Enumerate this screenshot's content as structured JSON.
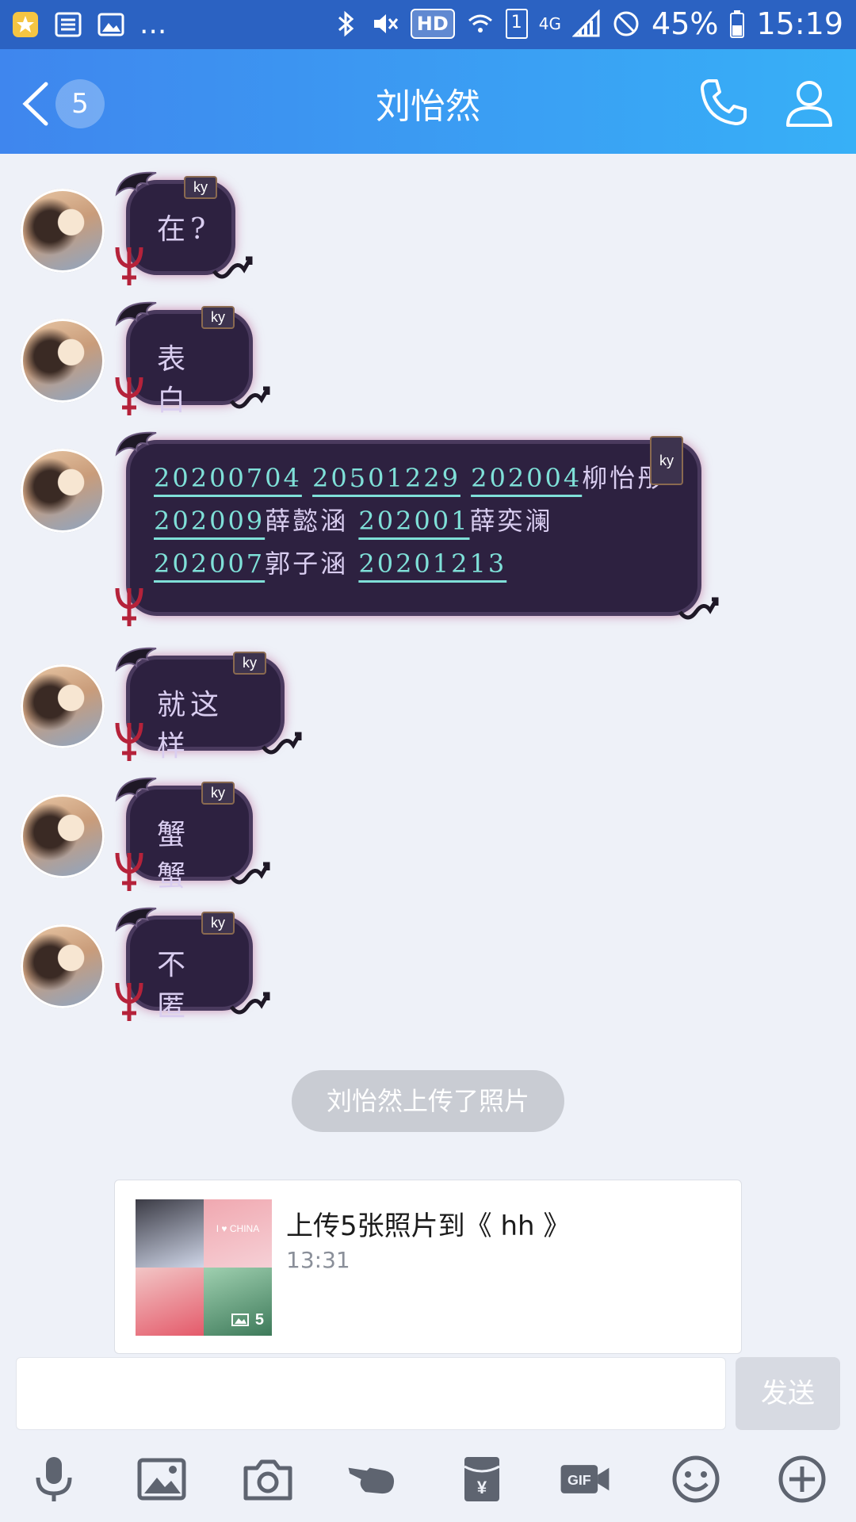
{
  "status_bar": {
    "dots": "...",
    "hd": "HD",
    "sim": "1",
    "network": "4G",
    "battery": "45%",
    "time": "15:19"
  },
  "header": {
    "unread_count": "5",
    "title": "刘怡然"
  },
  "messages": [
    {
      "text": "在?"
    },
    {
      "text": "表白"
    },
    {
      "segments": [
        {
          "text": "20200704",
          "link": true
        },
        {
          "text": " ",
          "link": false
        },
        {
          "text": "20501229",
          "link": true
        },
        {
          "text": " ",
          "link": false
        },
        {
          "text": "202004",
          "link": true
        },
        {
          "text": "柳怡彤",
          "link": false
        },
        {
          "text": "202009",
          "link": true
        },
        {
          "text": "薛懿涵 ",
          "link": false
        },
        {
          "text": "202001",
          "link": true
        },
        {
          "text": "薛奕澜 ",
          "link": false
        },
        {
          "text": "202007",
          "link": true
        },
        {
          "text": "郭子涵 ",
          "link": false
        },
        {
          "text": "20201213",
          "link": true
        }
      ]
    },
    {
      "text": "就这样"
    },
    {
      "text": "蟹蟹"
    },
    {
      "text": "不匿"
    }
  ],
  "bubble_badge": "ky",
  "system_notice": "刘怡然上传了照片",
  "photo_card": {
    "title": "上传5张照片到《 hh 》",
    "time": "13:31",
    "photo_count": "5",
    "thumb_text": "I ♥ CHINA"
  },
  "input": {
    "placeholder": "",
    "send_label": "发送"
  },
  "toolbar": [
    "microphone-icon",
    "image-icon",
    "camera-icon",
    "poke-hand-icon",
    "red-packet-icon",
    "gif-icon",
    "emoji-icon",
    "plus-icon"
  ]
}
